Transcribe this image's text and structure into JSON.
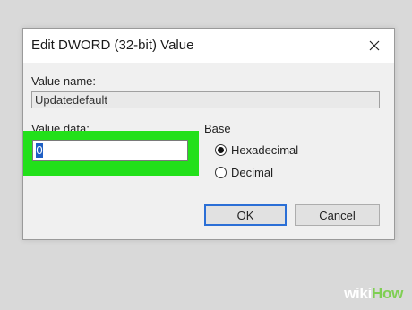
{
  "dialog": {
    "title": "Edit DWORD (32-bit) Value",
    "value_name_label": "Value name:",
    "value_name": "Updatedefault",
    "value_data_label": "Value data:",
    "value_data": "0",
    "base_label": "Base",
    "base_options": [
      {
        "label": "Hexadecimal",
        "selected": true
      },
      {
        "label": "Decimal",
        "selected": false
      }
    ],
    "ok_label": "OK",
    "cancel_label": "Cancel"
  },
  "watermark": {
    "wiki": "wiki",
    "how": "How"
  },
  "colors": {
    "highlight": "#22e01a",
    "selection": "#1f5fc4",
    "ok_border": "#2b6fd6"
  }
}
